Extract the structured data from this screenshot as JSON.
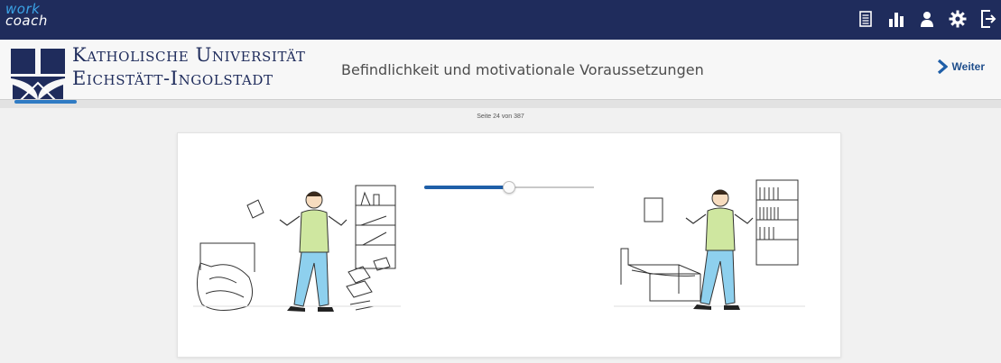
{
  "brand": {
    "line1": "work",
    "line2": "coach"
  },
  "toolbar": {
    "icons": [
      "document-icon",
      "chart-icon",
      "user-icon",
      "gear-icon",
      "logout-icon"
    ]
  },
  "header": {
    "university_line1": "Katholische Universität",
    "university_line2": "Eichstätt-Ingolstadt",
    "page_title": "Befindlichkeit und motivationale Voraussetzungen",
    "next_label": "Weiter"
  },
  "progress": {
    "current_page": 24,
    "total_pages": 387,
    "text": "Seite 24 von 387"
  },
  "slider": {
    "value": 0.5
  },
  "colors": {
    "topbar": "#1f2c5c",
    "accent": "#2f7bc4",
    "brand_work": "#3ba3e6"
  }
}
